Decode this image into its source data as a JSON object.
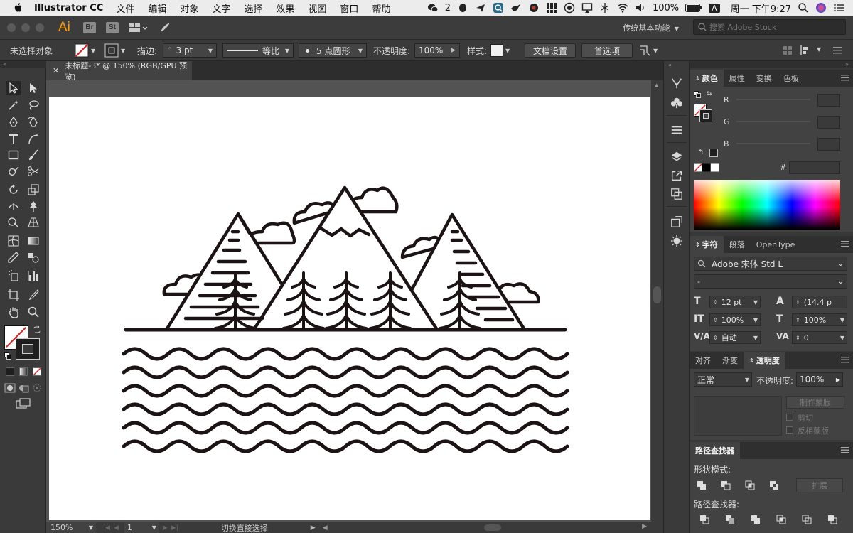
{
  "menubar": {
    "app_name": "Illustrator CC",
    "items": [
      "文件",
      "编辑",
      "对象",
      "文字",
      "选择",
      "效果",
      "视图",
      "窗口",
      "帮助"
    ],
    "wechat_count": "2",
    "battery": "100%",
    "input_method": "A",
    "clock": "周一 下午9:27"
  },
  "appbar": {
    "logo": "Ai",
    "bridge": "Br",
    "stock": "St",
    "workspace": "传统基本功能",
    "stock_search_placeholder": "搜索 Adobe Stock"
  },
  "control": {
    "selection_label": "未选择对象",
    "stroke_label": "描边:",
    "stroke_value": "3 pt",
    "profile_label": "等比",
    "brush_label": "5 点圆形",
    "opacity_label": "不透明度:",
    "opacity_value": "100%",
    "style_label": "样式:",
    "doc_setup": "文档设置",
    "preferences": "首选项"
  },
  "document": {
    "tab_title": "未标题-3* @ 150% (RGB/GPU 预览)",
    "zoom": "150%",
    "artboard_number": "1",
    "status_text": "切换直接选择"
  },
  "color_panel": {
    "tabs": [
      "颜色",
      "属性",
      "变换",
      "色板"
    ],
    "channels": [
      "R",
      "G",
      "B"
    ],
    "hex_label": "#"
  },
  "character_panel": {
    "tabs": [
      "字符",
      "段落",
      "OpenType"
    ],
    "font_family": "Adobe 宋体 Std L",
    "font_style": "-",
    "font_size": "12 pt",
    "leading": "(14.4 p",
    "vertical_scale": "100%",
    "horizontal_scale": "100%",
    "kerning": "自动",
    "tracking": "0"
  },
  "transparency_panel": {
    "tabs": [
      "对齐",
      "渐变",
      "透明度"
    ],
    "blend_mode": "正常",
    "opacity_label": "不透明度:",
    "opacity_value": "100%",
    "make_mask": "制作蒙版",
    "clip": "剪切",
    "invert_mask": "反相蒙版"
  },
  "pathfinder_panel": {
    "title": "路径查找器",
    "shape_modes_label": "形状模式:",
    "expand": "扩展",
    "pathfinders_label": "路径查找器:"
  }
}
